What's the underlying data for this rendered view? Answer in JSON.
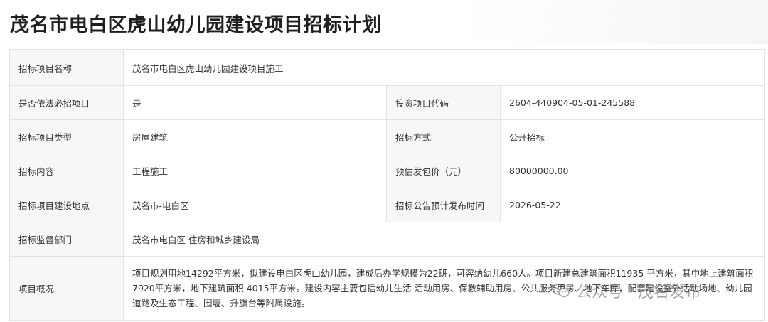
{
  "page": {
    "title": "茂名市电白区虎山幼儿园建设项目招标计划"
  },
  "rows": {
    "r1": {
      "label": "招标项目名称",
      "value": "茂名市电白区虎山幼儿园建设项目施工"
    },
    "r2": {
      "label1": "是否依法必招项目",
      "value1": "是",
      "label2": "投资项目代码",
      "value2": "2604-440904-05-01-245588"
    },
    "r3": {
      "label1": "招标项目类型",
      "value1": "房屋建筑",
      "label2": "招标方式",
      "value2": "公开招标"
    },
    "r4": {
      "label1": "招标内容",
      "value1": "工程施工",
      "label2": "预估发包价（元）",
      "value2": "80000000.00"
    },
    "r5": {
      "label1": "招标项目建设地点",
      "value1": "茂名市-电白区",
      "label2": "招标公告预计发布时间",
      "value2": "2026-05-22"
    },
    "r6": {
      "label": "招标监督部门",
      "value": "茂名市电白区 住房和城乡建设局"
    },
    "r7": {
      "label": "项目概况",
      "value": "项目规划用地14292平方米，拟建设电白区虎山幼儿园，建成后办学规模为22班，可容纳幼儿660人。项目新建总建筑面积11935 平方米，其中地上建筑面积7920平方米，地下建筑面积 4015平方米。建设内容主要包括幼儿生活 活动用房、保教辅助用房、公共服务用房、地下车库，配套建设室外活动场地、幼儿园道路及生态工程、围墙、升旗台等附属设施。"
    }
  },
  "watermark": {
    "icon": "wechat-icon",
    "text": "公众号 · 茂名发布"
  }
}
